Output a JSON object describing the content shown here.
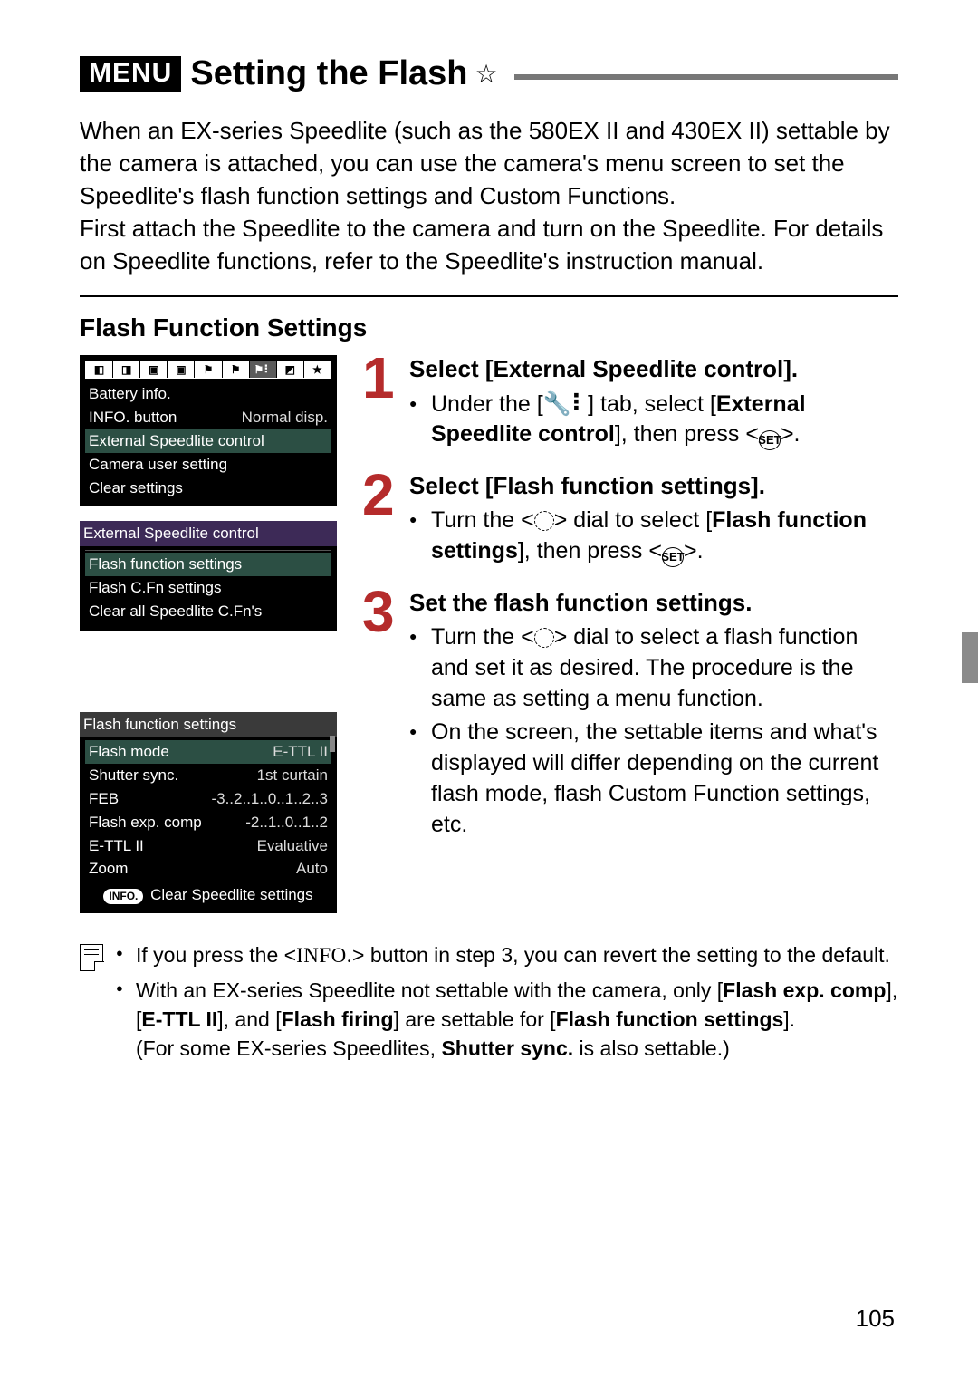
{
  "header": {
    "menu_badge": "MENU",
    "title": "Setting the Flash",
    "star": "☆"
  },
  "intro": [
    "When an EX-series Speedlite (such as the 580EX II and 430EX II) settable by the camera is attached, you can use the camera's menu screen to set the Speedlite's flash function settings and Custom Functions.",
    "First attach the Speedlite to the camera and turn on the Speedlite. For details on Speedlite functions, refer to the Speedlite's instruction manual."
  ],
  "subheading": "Flash Function Settings",
  "lcd1": {
    "items": [
      {
        "label": "Battery info.",
        "value": ""
      },
      {
        "label": "INFO. button",
        "value": "Normal disp."
      },
      {
        "label": "External Speedlite control",
        "value": "",
        "hl": true
      },
      {
        "label": "Camera user setting",
        "value": ""
      },
      {
        "label": "Clear settings",
        "value": ""
      }
    ]
  },
  "lcd2": {
    "head": "External Speedlite control",
    "items": [
      {
        "label": "Flash function settings",
        "hl": true
      },
      {
        "label": "Flash C.Fn settings",
        "hl": false
      },
      {
        "label": "Clear all Speedlite C.Fn's",
        "hl": false
      }
    ]
  },
  "lcd3": {
    "head": "Flash function settings",
    "rows": [
      {
        "label": "Flash mode",
        "value": "E-TTL II"
      },
      {
        "label": "Shutter sync.",
        "value": "1st curtain"
      },
      {
        "label": "FEB",
        "value": "-3..2..1..0..1..2..3"
      },
      {
        "label": "Flash exp. comp",
        "value": "-2..1..0..1..2"
      },
      {
        "label": "E-TTL II",
        "value": "Evaluative"
      },
      {
        "label": "Zoom",
        "value": "Auto"
      }
    ],
    "footer_pill": "INFO.",
    "footer_text": "Clear Speedlite settings"
  },
  "steps": [
    {
      "num": "1",
      "title": "Select [External Speedlite control].",
      "bullets": [
        {
          "pre": "Under the [",
          "icon": "wrench-dots",
          "mid": "] tab, select [",
          "bold1": "External Speedlite control",
          "post1": "], then press <",
          "seticon": true,
          "post2": ">."
        }
      ]
    },
    {
      "num": "2",
      "title": "Select [Flash function settings].",
      "bullets": [
        {
          "pre": "Turn the <",
          "icon": "dial",
          "mid": "> dial to select [",
          "bold1": "Flash function settings",
          "post1": "], then press <",
          "seticon": true,
          "post2": ">."
        }
      ]
    },
    {
      "num": "3",
      "title": "Set the flash function settings.",
      "bullets": [
        {
          "pre": "Turn the <",
          "icon": "dial",
          "mid": "> dial to select a flash function and set it as desired. The procedure is the same as setting a menu function."
        },
        {
          "plain": "On the screen, the settable items and what's displayed will differ depending on the current flash mode, flash Custom Function settings, etc."
        }
      ]
    }
  ],
  "notes": [
    {
      "pre": "If you press the <",
      "info_icon_text": "INFO.",
      "post": "> button in step 3, you can revert the setting to the default."
    },
    {
      "segments": [
        {
          "t": "With an EX-series Speedlite not settable with the camera, only ["
        },
        {
          "b": "Flash exp. comp"
        },
        {
          "t": "], ["
        },
        {
          "b": "E-TTL II"
        },
        {
          "t": "], and ["
        },
        {
          "b": "Flash firing"
        },
        {
          "t": "] are settable for ["
        },
        {
          "b": "Flash function settings"
        },
        {
          "t": "]."
        }
      ],
      "tail": "(For some EX-series Speedlites, Shutter sync. is also settable.)",
      "tail_bold": "Shutter sync."
    }
  ],
  "page_number": "105"
}
